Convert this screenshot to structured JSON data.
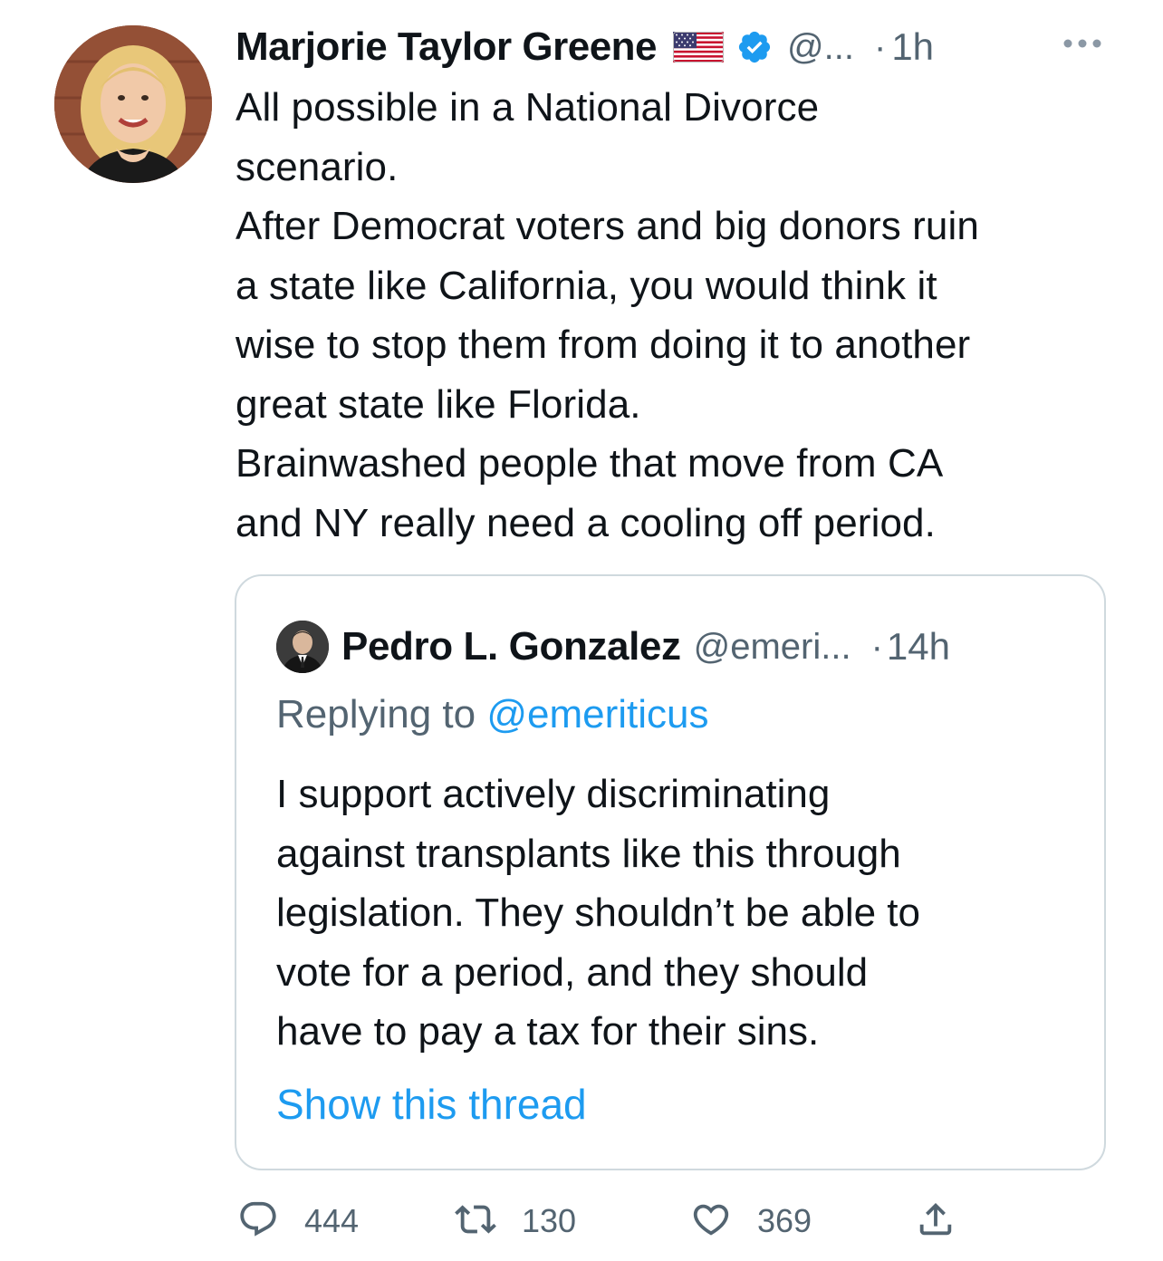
{
  "tweet": {
    "author_name": "Marjorie Taylor Greene",
    "handle": "@...",
    "separator": "·",
    "time": "1h",
    "body": "All possible in a National Divorce\nscenario.\nAfter Democrat voters and big donors ruin\na state like California, you would think it\nwise to stop them from doing it to another\ngreat state like Florida.\nBrainwashed people that move from CA\nand NY really need a cooling off period.",
    "icons": [
      "us-flag-emoji",
      "verified-badge-icon",
      "more-options-icon"
    ]
  },
  "quoted_tweet": {
    "author_name": "Pedro L. Gonzalez",
    "handle": "@emeri...",
    "separator": "·",
    "time": "14h",
    "replying_prefix": "Replying to ",
    "replying_handle": "@emeriticus",
    "body": "I support actively discriminating\nagainst transplants like this through\nlegislation. They shouldn’t be able to\nvote for a period, and they should\nhave to pay a tax for their sins.",
    "show_thread": "Show this thread"
  },
  "actions": {
    "replies": "444",
    "retweets": "130",
    "likes": "369",
    "icons": [
      "reply-icon",
      "retweet-icon",
      "like-icon",
      "share-icon"
    ]
  },
  "colors": {
    "text": "#0f1419",
    "secondary": "#536471",
    "link": "#1d9bf0",
    "border": "#cfd9de"
  }
}
